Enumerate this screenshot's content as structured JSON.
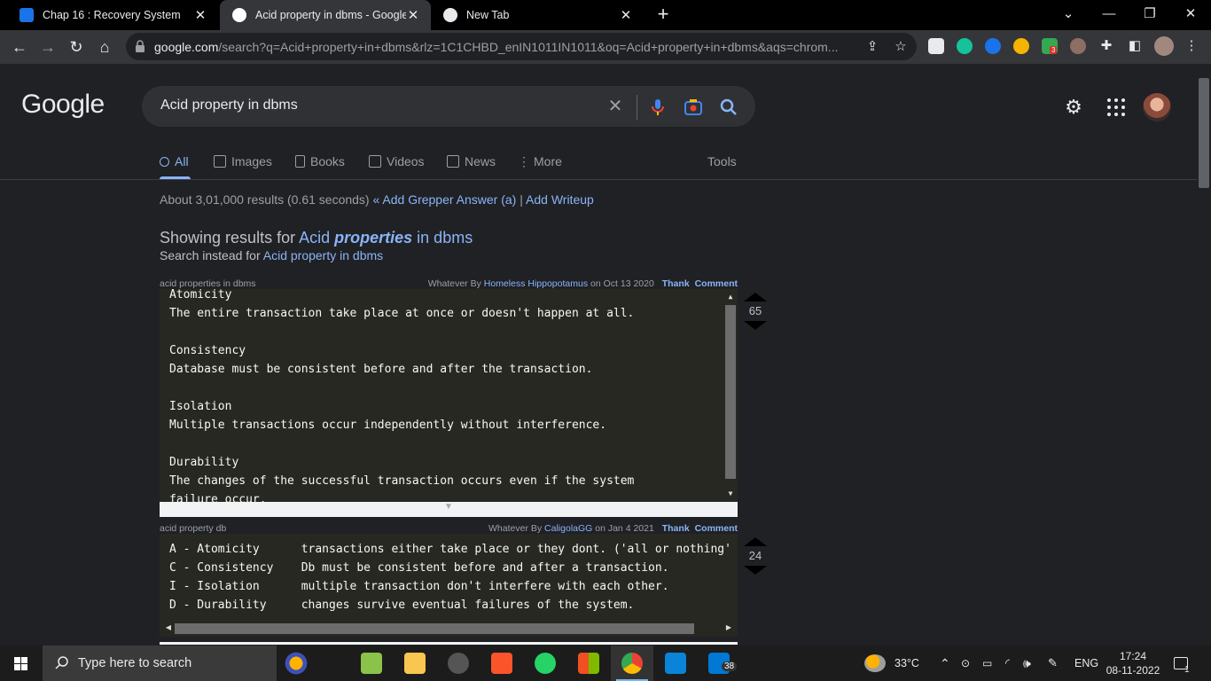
{
  "browser": {
    "tabs": [
      {
        "title": "Chap 16 : Recovery System",
        "favicon_color": "#1a73e8"
      },
      {
        "title": "Acid property in dbms - Google S",
        "favicon_color": "#e8eaed"
      },
      {
        "title": "New Tab",
        "favicon_color": "#e8eaed"
      }
    ],
    "url_domain": "google.com",
    "url_rest": "/search?q=Acid+property+in+dbms&rlz=1C1CHBD_enIN1011IN1011&oq=Acid+property+in+dbms&aqs=chrom..."
  },
  "google": {
    "logo": "Google",
    "query": "Acid property in dbms",
    "nav": [
      {
        "label": "All",
        "icon": "search-icon"
      },
      {
        "label": "Images",
        "icon": "image-icon"
      },
      {
        "label": "Books",
        "icon": "book-icon"
      },
      {
        "label": "Videos",
        "icon": "video-icon"
      },
      {
        "label": "News",
        "icon": "news-icon"
      },
      {
        "label": "More",
        "icon": "more-vert-icon"
      }
    ],
    "tools": "Tools",
    "stats": "About 3,01,000 results (0.61 seconds)",
    "grepper_add": "« Add Grepper Answer (a)",
    "stats_sep": "|",
    "add_writeup": "Add Writeup",
    "showing_prefix": "Showing results for",
    "showing_link_a": "Acid",
    "showing_link_b": "properties",
    "showing_link_c": "in dbms",
    "instead_prefix": "Search instead for",
    "instead_link": "Acid property in dbms"
  },
  "answers": [
    {
      "query": "acid properties in dbms",
      "meta_prefix": "Whatever By",
      "author": "Homeless Hippopotamus",
      "date": "on Oct 13 2020",
      "thank": "Thank",
      "comment": "Comment",
      "votes": "65",
      "code": "Atomicity\nThe entire transaction take place at once or doesn't happen at all.\n\nConsistency\nDatabase must be consistent before and after the transaction.\n\nIsolation\nMultiple transactions occur independently without interference.\n\nDurability\nThe changes of the successful transaction occurs even if the system\nfailure occur."
    },
    {
      "query": "acid property db",
      "meta_prefix": "Whatever By",
      "author": "CaligolaGG",
      "date": "on Jan 4 2021",
      "thank": "Thank",
      "comment": "Comment",
      "votes": "24",
      "code": "A - Atomicity      transactions either take place or they dont. ('all or nothing' pr\nC - Consistency    Db must be consistent before and after a transaction.\nI - Isolation      multiple transaction don't interfere with each other.\nD - Durability     changes survive eventual failures of the system."
    }
  ],
  "taskbar": {
    "search_placeholder": "Type here to search",
    "weather": "33°C",
    "lang": "ENG",
    "time": "17:24",
    "date": "08-11-2022",
    "notif_count": "1",
    "badge_38": "38",
    "ext_badge": "3"
  },
  "colors": {
    "link": "#8ab4f8",
    "bg": "#202124",
    "code_bg": "#272822"
  }
}
